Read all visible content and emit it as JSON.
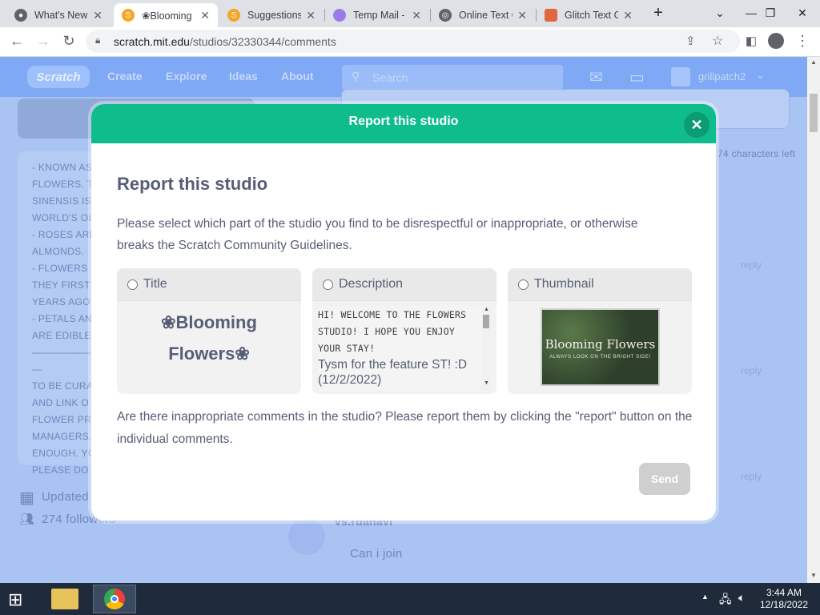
{
  "tabs": [
    {
      "title": "What's New",
      "color": "#5f6368"
    },
    {
      "title": "❀Blooming",
      "color": "#f5a623"
    },
    {
      "title": "Suggestions",
      "color": "#f5a623"
    },
    {
      "title": "Temp Mail -",
      "color": "#9b7be8"
    },
    {
      "title": "Online Text G",
      "color": "#5f6368"
    },
    {
      "title": "Glitch Text G",
      "color": "#e0673f"
    }
  ],
  "browser": {
    "url_domain": "scratch.mit.edu",
    "url_path": "/studios/32330344/comments"
  },
  "scratch_nav": {
    "logo": "Scratch",
    "links": [
      "Create",
      "Explore",
      "Ideas",
      "About"
    ],
    "search_placeholder": "Search",
    "username": "grillpatch2"
  },
  "background": {
    "left_lines": [
      "- KNOWN AS",
      "FLOWERS. T",
      "SINENSIS IS",
      "WORLD'S OL",
      "- ROSES ARE",
      "ALMONDS.",
      "- FLOWERS I",
      "THEY FIRST",
      "YEARS AGO",
      "- PETALS AN",
      "ARE EDIBLE",
      "——————",
      "—",
      "TO BE CURA",
      "AND LINK O",
      "FLOWER PRO",
      "MANAGERS,",
      "ENOUGH. YO",
      "PLEASE DO"
    ],
    "updated": "Updated",
    "followers": "274 followers",
    "chars_left": "74 characters left",
    "reply": "reply",
    "comment_user": "vs.rdanavi",
    "comment_text": "Can i join"
  },
  "modal": {
    "header": "Report this studio",
    "title": "Report this studio",
    "description": "Please select which part of the studio you find to be disrespectful or inappropriate, or otherwise breaks the Scratch Community Guidelines.",
    "options": {
      "title_label": "Title",
      "description_label": "Description",
      "thumbnail_label": "Thumbnail"
    },
    "studio_title_line1": "❀Blooming",
    "studio_title_line2": "Flowers❀",
    "studio_desc_pixel1": "HI! WELCOME TO THE FLOWERS",
    "studio_desc_pixel2": "STUDIO! I HOPE YOU ENJOY",
    "studio_desc_pixel3": "YOUR STAY!",
    "studio_desc_normal": "Tysm for the feature ST! :D (12/2/2022)",
    "thumbnail_title": "Blooming Flowers",
    "thumbnail_subtitle": "ALWAYS LOOK ON THE BRIGHT SIDE!",
    "comments_note": "Are there inappropriate comments in the studio? Please report them by clicking the \"report\" button on the individual comments.",
    "send_label": "Send"
  },
  "taskbar": {
    "time": "3:44 AM",
    "date": "12/18/2022"
  }
}
